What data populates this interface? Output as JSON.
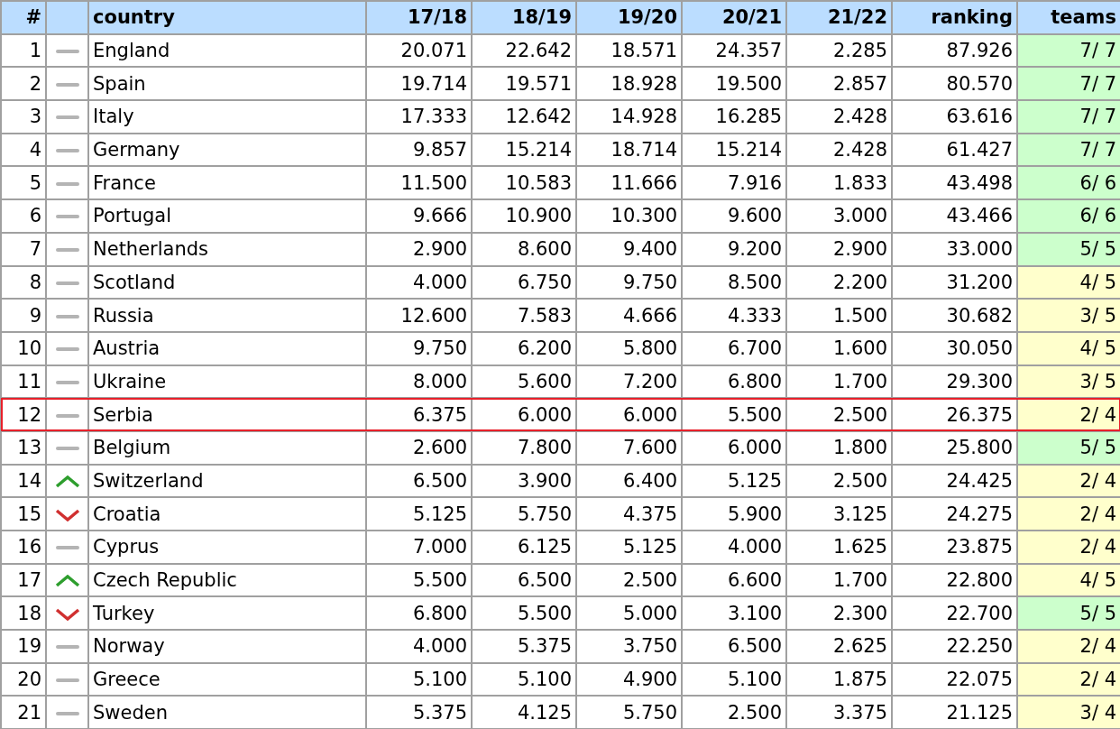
{
  "table": {
    "columns": [
      "#",
      "country",
      "17/18",
      "18/19",
      "19/20",
      "20/21",
      "21/22",
      "ranking",
      "teams"
    ],
    "rows": [
      {
        "rank": "1",
        "kind": "same",
        "country": "England",
        "scores": [
          "20.071",
          "22.642",
          "18.571",
          "24.357",
          "2.285"
        ],
        "ranking": "87.926",
        "teams": "7/ 7",
        "complete": true,
        "highlighted": false
      },
      {
        "rank": "2",
        "kind": "same",
        "country": "Spain",
        "scores": [
          "19.714",
          "19.571",
          "18.928",
          "19.500",
          "2.857"
        ],
        "ranking": "80.570",
        "teams": "7/ 7",
        "complete": true,
        "highlighted": false
      },
      {
        "rank": "3",
        "kind": "same",
        "country": "Italy",
        "scores": [
          "17.333",
          "12.642",
          "14.928",
          "16.285",
          "2.428"
        ],
        "ranking": "63.616",
        "teams": "7/ 7",
        "complete": true,
        "highlighted": false
      },
      {
        "rank": "4",
        "kind": "same",
        "country": "Germany",
        "scores": [
          "9.857",
          "15.214",
          "18.714",
          "15.214",
          "2.428"
        ],
        "ranking": "61.427",
        "teams": "7/ 7",
        "complete": true,
        "highlighted": false
      },
      {
        "rank": "5",
        "kind": "same",
        "country": "France",
        "scores": [
          "11.500",
          "10.583",
          "11.666",
          "7.916",
          "1.833"
        ],
        "ranking": "43.498",
        "teams": "6/ 6",
        "complete": true,
        "highlighted": false
      },
      {
        "rank": "6",
        "kind": "same",
        "country": "Portugal",
        "scores": [
          "9.666",
          "10.900",
          "10.300",
          "9.600",
          "3.000"
        ],
        "ranking": "43.466",
        "teams": "6/ 6",
        "complete": true,
        "highlighted": false
      },
      {
        "rank": "7",
        "kind": "same",
        "country": "Netherlands",
        "scores": [
          "2.900",
          "8.600",
          "9.400",
          "9.200",
          "2.900"
        ],
        "ranking": "33.000",
        "teams": "5/ 5",
        "complete": true,
        "highlighted": false
      },
      {
        "rank": "8",
        "kind": "same",
        "country": "Scotland",
        "scores": [
          "4.000",
          "6.750",
          "9.750",
          "8.500",
          "2.200"
        ],
        "ranking": "31.200",
        "teams": "4/ 5",
        "complete": false,
        "highlighted": false
      },
      {
        "rank": "9",
        "kind": "same",
        "country": "Russia",
        "scores": [
          "12.600",
          "7.583",
          "4.666",
          "4.333",
          "1.500"
        ],
        "ranking": "30.682",
        "teams": "3/ 5",
        "complete": false,
        "highlighted": false
      },
      {
        "rank": "10",
        "kind": "same",
        "country": "Austria",
        "scores": [
          "9.750",
          "6.200",
          "5.800",
          "6.700",
          "1.600"
        ],
        "ranking": "30.050",
        "teams": "4/ 5",
        "complete": false,
        "highlighted": false
      },
      {
        "rank": "11",
        "kind": "same",
        "country": "Ukraine",
        "scores": [
          "8.000",
          "5.600",
          "7.200",
          "6.800",
          "1.700"
        ],
        "ranking": "29.300",
        "teams": "3/ 5",
        "complete": false,
        "highlighted": false
      },
      {
        "rank": "12",
        "kind": "same",
        "country": "Serbia",
        "scores": [
          "6.375",
          "6.000",
          "6.000",
          "5.500",
          "2.500"
        ],
        "ranking": "26.375",
        "teams": "2/ 4",
        "complete": false,
        "highlighted": true
      },
      {
        "rank": "13",
        "kind": "same",
        "country": "Belgium",
        "scores": [
          "2.600",
          "7.800",
          "7.600",
          "6.000",
          "1.800"
        ],
        "ranking": "25.800",
        "teams": "5/ 5",
        "complete": true,
        "highlighted": false
      },
      {
        "rank": "14",
        "kind": "up",
        "country": "Switzerland",
        "scores": [
          "6.500",
          "3.900",
          "6.400",
          "5.125",
          "2.500"
        ],
        "ranking": "24.425",
        "teams": "2/ 4",
        "complete": false,
        "highlighted": false
      },
      {
        "rank": "15",
        "kind": "down",
        "country": "Croatia",
        "scores": [
          "5.125",
          "5.750",
          "4.375",
          "5.900",
          "3.125"
        ],
        "ranking": "24.275",
        "teams": "2/ 4",
        "complete": false,
        "highlighted": false
      },
      {
        "rank": "16",
        "kind": "same",
        "country": "Cyprus",
        "scores": [
          "7.000",
          "6.125",
          "5.125",
          "4.000",
          "1.625"
        ],
        "ranking": "23.875",
        "teams": "2/ 4",
        "complete": false,
        "highlighted": false
      },
      {
        "rank": "17",
        "kind": "up",
        "country": "Czech Republic",
        "scores": [
          "5.500",
          "6.500",
          "2.500",
          "6.600",
          "1.700"
        ],
        "ranking": "22.800",
        "teams": "4/ 5",
        "complete": false,
        "highlighted": false
      },
      {
        "rank": "18",
        "kind": "down",
        "country": "Turkey",
        "scores": [
          "6.800",
          "5.500",
          "5.000",
          "3.100",
          "2.300"
        ],
        "ranking": "22.700",
        "teams": "5/ 5",
        "complete": true,
        "highlighted": false
      },
      {
        "rank": "19",
        "kind": "same",
        "country": "Norway",
        "scores": [
          "4.000",
          "5.375",
          "3.750",
          "6.500",
          "2.625"
        ],
        "ranking": "22.250",
        "teams": "2/ 4",
        "complete": false,
        "highlighted": false
      },
      {
        "rank": "20",
        "kind": "same",
        "country": "Greece",
        "scores": [
          "5.100",
          "5.100",
          "4.900",
          "5.100",
          "1.875"
        ],
        "ranking": "22.075",
        "teams": "2/ 4",
        "complete": false,
        "highlighted": false
      },
      {
        "rank": "21",
        "kind": "same",
        "country": "Sweden",
        "scores": [
          "5.375",
          "4.125",
          "5.750",
          "2.500",
          "3.375"
        ],
        "ranking": "21.125",
        "teams": "3/ 4",
        "complete": false,
        "highlighted": false
      }
    ]
  }
}
